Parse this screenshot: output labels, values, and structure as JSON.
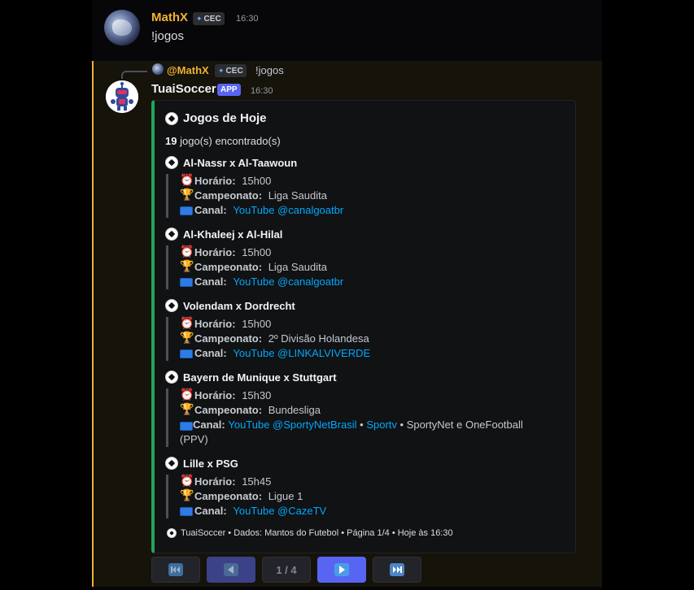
{
  "message1": {
    "author": "MathX",
    "tag": "CEC",
    "time": "16:30",
    "text": "!jogos"
  },
  "reply": {
    "author": "@MathX",
    "tag": "CEC",
    "text": "!jogos"
  },
  "message2": {
    "author": "TuaiSoccer",
    "badge": "APP",
    "time": "16:30"
  },
  "embed": {
    "title": "Jogos de Hoje",
    "count": "19",
    "count_suffix": "jogo(s) encontrado(s)",
    "accent_color": "#23a55a",
    "labels": {
      "horario": "Horário:",
      "campeonato": "Campeonato:",
      "canal": "Canal:"
    },
    "games": [
      {
        "title": "Al-Nassr x Al-Taawoun",
        "horario": "15h00",
        "campeonato": "Liga Saudita",
        "canal_link": "YouTube @canalgoatbr"
      },
      {
        "title": "Al-Khaleej x Al-Hilal",
        "horario": "15h00",
        "campeonato": "Liga Saudita",
        "canal_link": "YouTube @canalgoatbr"
      },
      {
        "title": "Volendam x Dordrecht",
        "horario": "15h00",
        "campeonato": "2º Divisão Holandesa",
        "canal_link": "YouTube @LINKALVIVERDE"
      },
      {
        "title": "Bayern de Munique x Stuttgart",
        "horario": "15h30",
        "campeonato": "Bundesliga",
        "canal_link": "YouTube @SportyNetBrasil",
        "canal_link2": "Sportv",
        "canal_rest": "SportyNet e OneFootball (PPV)"
      },
      {
        "title": "Lille x PSG",
        "horario": "15h45",
        "campeonato": "Ligue 1",
        "canal_link": "YouTube @CazeTV"
      }
    ],
    "footer": "TuaiSoccer • Dados: Mantos do Futebol • Página 1/4 • Hoje às 16:30"
  },
  "pagination": {
    "page_label": "1 / 4"
  }
}
